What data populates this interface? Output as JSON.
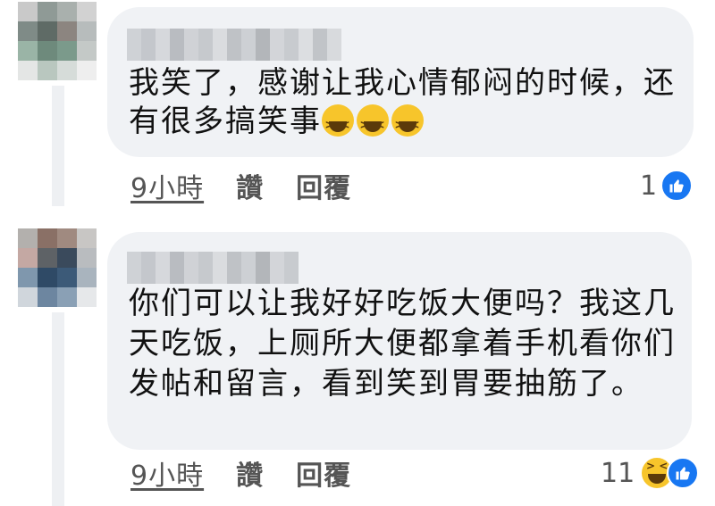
{
  "comments": [
    {
      "text": "我笑了，感谢让我心情郁闷的时候，还有很多搞笑事",
      "emojis": [
        "laughing-face-emoji",
        "laughing-face-emoji",
        "laughing-face-emoji"
      ],
      "time": "9小時",
      "like_label": "讚",
      "reply_label": "回覆",
      "reaction_count": "1",
      "reactions": [
        "like-reaction"
      ]
    },
    {
      "text": "你们可以让我好好吃饭大便吗？我这几天吃饭，上厕所大便都拿着手机看你们发帖和留言，看到笑到胃要抽筋了。",
      "emojis": [],
      "time": "9小時",
      "like_label": "讚",
      "reply_label": "回覆",
      "reaction_count": "11",
      "reactions": [
        "haha-reaction",
        "like-reaction"
      ]
    }
  ],
  "colors": {
    "bubble": "#f0f2f5",
    "like_blue": "#1877f2",
    "meta_text": "#555555",
    "body_text": "#111111"
  }
}
